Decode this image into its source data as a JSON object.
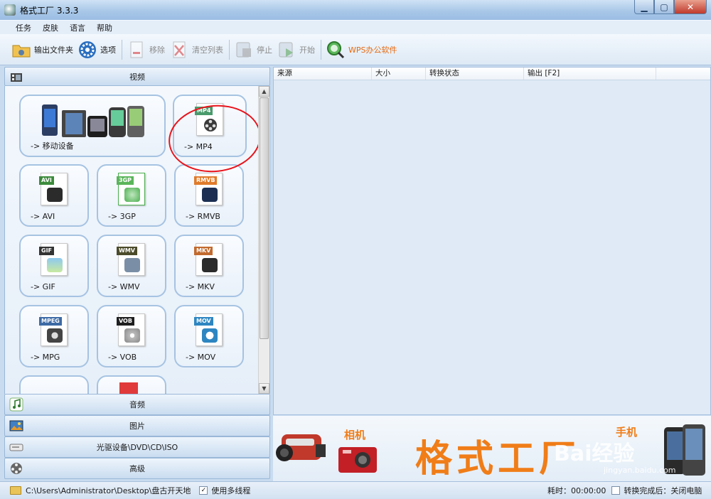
{
  "window": {
    "title": "格式工厂 3.3.3"
  },
  "menu": [
    "任务",
    "皮肤",
    "语言",
    "帮助"
  ],
  "toolbar": {
    "output_folder": "输出文件夹",
    "options": "选项",
    "remove": "移除",
    "clear_list": "清空列表",
    "stop": "停止",
    "start": "开始",
    "wps": "WPS办公软件"
  },
  "categories": {
    "video": "视频",
    "audio": "音频",
    "image": "图片",
    "disc": "光驱设备\\DVD\\CD\\ISO",
    "advanced": "高级"
  },
  "tiles": [
    {
      "label": "-> 移动设备"
    },
    {
      "label": "-> MP4",
      "tag": "MP4"
    },
    {
      "label": "-> AVI",
      "tag": "AVI"
    },
    {
      "label": "-> 3GP",
      "tag": "3GP"
    },
    {
      "label": "-> RMVB",
      "tag": "RMVB"
    },
    {
      "label": "-> GIF",
      "tag": "GIF"
    },
    {
      "label": "-> WMV",
      "tag": "WMV"
    },
    {
      "label": "-> MKV",
      "tag": "MKV"
    },
    {
      "label": "-> MPG",
      "tag": "MPEG"
    },
    {
      "label": "-> VOB",
      "tag": "VOB"
    },
    {
      "label": "-> MOV",
      "tag": "MOV"
    }
  ],
  "table": {
    "columns": [
      "来源",
      "大小",
      "转换状态",
      "输出 [F2]"
    ]
  },
  "banner": {
    "title": "格式工厂",
    "camera_label": "相机",
    "phone_label": "手机",
    "watermark": "Bai经验",
    "watermark_url": "jingyan.baidu.com"
  },
  "status": {
    "path": "C:\\Users\\Administrator\\Desktop\\盘古开天地",
    "multithread_label": "使用多线程",
    "multithread_checked": "✓",
    "elapsed": "耗时：00:00:00",
    "after_label": "转换完成后：关闭电脑"
  },
  "colors": {
    "accent_orange": "#f07d18",
    "annotation_red": "#e8141c",
    "panel_blue": "#dfeaf6"
  }
}
